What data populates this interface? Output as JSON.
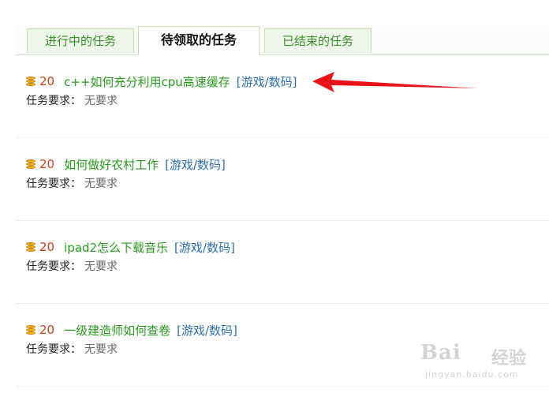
{
  "tabs": [
    {
      "label": "进行中的任务",
      "active": false
    },
    {
      "label": "待领取的任务",
      "active": true
    },
    {
      "label": "已结束的任务",
      "active": false
    }
  ],
  "tasks": [
    {
      "points": "20",
      "title": "c++如何充分利用cpu高速缓存",
      "category": "[游戏/数码]",
      "requirement_label": "任务要求：",
      "requirement_value": "无要求"
    },
    {
      "points": "20",
      "title": "如何做好农村工作",
      "category": "[游戏/数码]",
      "requirement_label": "任务要求：",
      "requirement_value": "无要求"
    },
    {
      "points": "20",
      "title": "ipad2怎么下载音乐",
      "category": "[游戏/数码]",
      "requirement_label": "任务要求：",
      "requirement_value": "无要求"
    },
    {
      "points": "20",
      "title": "一级建造师如何查卷",
      "category": "[游戏/数码]",
      "requirement_label": "任务要求：",
      "requirement_value": "无要求"
    }
  ],
  "colors": {
    "points": "#d0421b",
    "title": "#2a9a1f",
    "category": "#2f6fb0",
    "annotation_arrow": "#e8141a"
  },
  "icons": {
    "coin": "coin-stack-icon"
  },
  "watermark": {
    "brand": "Bai",
    "brand2": "经验",
    "url": "jingyan.baidu.com"
  }
}
